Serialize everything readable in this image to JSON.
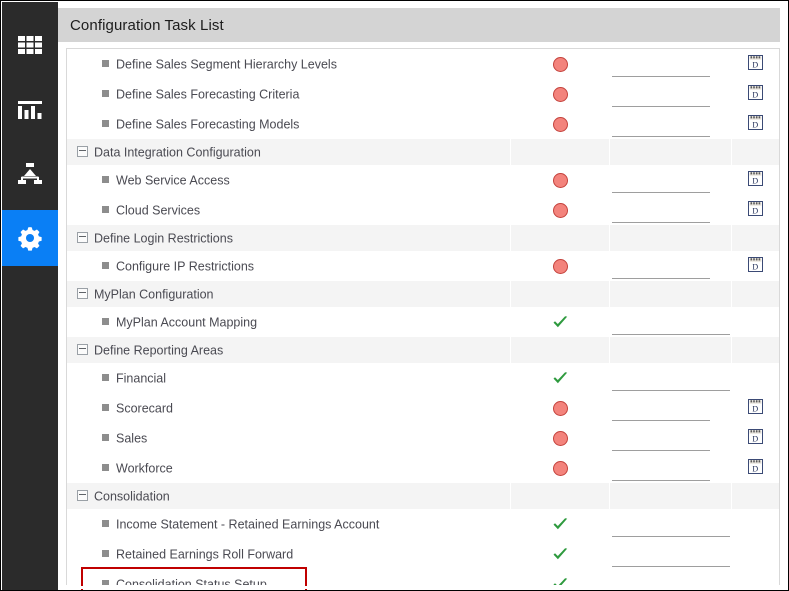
{
  "app": {
    "title": "Configuration Task List"
  },
  "sidebar": {
    "items": [
      {
        "name": "grid-icon",
        "label": "Grid",
        "active": false
      },
      {
        "name": "bar-chart-icon",
        "label": "Reports",
        "active": false
      },
      {
        "name": "hierarchy-icon",
        "label": "Hierarchy",
        "active": false
      },
      {
        "name": "gear-icon",
        "label": "Settings",
        "active": true
      }
    ]
  },
  "colors": {
    "rail_background": "#2b2b2b",
    "active_nav": "#0a7ff5",
    "title_bar": "#d4d4d4",
    "group_row": "#f4f4f4",
    "status_incomplete": "#f3837c",
    "status_incomplete_border": "#c4423c",
    "status_complete": "#2e9a3e",
    "highlight_border": "#c00000",
    "text": "#4a4a52"
  },
  "icons": {
    "calendar": "calendar-icon",
    "properties": "document-properties-icon",
    "expander": "collapse-minus-icon",
    "leaf_bullet": "task-bullet-icon",
    "status_incomplete": "status-incomplete-icon",
    "status_complete": "status-complete-icon"
  },
  "highlight": {
    "target_row_label": "Consolidation Status Setup"
  },
  "rows": [
    {
      "type": "task",
      "label": "Define Sales Segment Hierarchy Levels",
      "status": "incomplete",
      "date": "",
      "has_calendar": true,
      "has_properties": true
    },
    {
      "type": "task",
      "label": "Define Sales Forecasting Criteria",
      "status": "incomplete",
      "date": "",
      "has_calendar": true,
      "has_properties": true
    },
    {
      "type": "task",
      "label": "Define Sales Forecasting Models",
      "status": "incomplete",
      "date": "",
      "has_calendar": true,
      "has_properties": true
    },
    {
      "type": "group",
      "label": "Data Integration Configuration"
    },
    {
      "type": "task",
      "label": "Web Service Access",
      "status": "incomplete",
      "date": "",
      "has_calendar": true,
      "has_properties": true
    },
    {
      "type": "task",
      "label": "Cloud Services",
      "status": "incomplete",
      "date": "",
      "has_calendar": true,
      "has_properties": true
    },
    {
      "type": "group",
      "label": "Define Login Restrictions"
    },
    {
      "type": "task",
      "label": "Configure IP Restrictions",
      "status": "incomplete",
      "date": "",
      "has_calendar": true,
      "has_properties": true
    },
    {
      "type": "group",
      "label": "MyPlan Configuration"
    },
    {
      "type": "task",
      "label": "MyPlan Account Mapping",
      "status": "complete",
      "date": "",
      "has_calendar": false,
      "has_properties": true
    },
    {
      "type": "group",
      "label": "Define Reporting Areas"
    },
    {
      "type": "task",
      "label": "Financial",
      "status": "complete",
      "date": "",
      "has_calendar": false,
      "has_properties": true
    },
    {
      "type": "task",
      "label": "Scorecard",
      "status": "incomplete",
      "date": "",
      "has_calendar": true,
      "has_properties": true
    },
    {
      "type": "task",
      "label": "Sales",
      "status": "incomplete",
      "date": "",
      "has_calendar": true,
      "has_properties": true
    },
    {
      "type": "task",
      "label": "Workforce",
      "status": "incomplete",
      "date": "",
      "has_calendar": true,
      "has_properties": true
    },
    {
      "type": "group",
      "label": "Consolidation"
    },
    {
      "type": "task",
      "label": "Income Statement - Retained Earnings Account",
      "status": "complete",
      "date": "",
      "has_calendar": false,
      "has_properties": true
    },
    {
      "type": "task",
      "label": "Retained Earnings Roll Forward",
      "status": "complete",
      "date": "",
      "has_calendar": false,
      "has_properties": true
    },
    {
      "type": "task",
      "label": "Consolidation Status Setup",
      "status": "complete",
      "date": "",
      "has_calendar": false,
      "has_properties": true,
      "highlighted": true
    }
  ]
}
